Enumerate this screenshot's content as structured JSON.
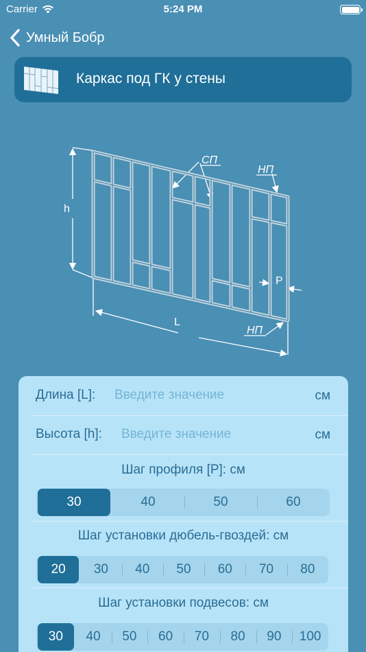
{
  "status_bar": {
    "carrier": "Carrier",
    "time": "5:24 PM"
  },
  "nav": {
    "back_label": "Умный Бобр"
  },
  "header": {
    "title": "Каркас под ГК у стены",
    "icon": "drywall-frame-icon"
  },
  "diagram": {
    "labels": {
      "sp": "СП",
      "np_top": "НП",
      "np_bottom": "НП",
      "h": "h",
      "l": "L",
      "p": "P"
    }
  },
  "form": {
    "length": {
      "label": "Длина [L]:",
      "placeholder": "Введите значение",
      "unit": "см",
      "value": ""
    },
    "height": {
      "label": "Высота [h]:",
      "placeholder": "Введите значение",
      "unit": "см",
      "value": ""
    },
    "profile_step": {
      "label": "Шаг профиля [P]: см",
      "options": [
        "30",
        "40",
        "50",
        "60"
      ],
      "selected": "30"
    },
    "dowel_step": {
      "label": "Шаг установки дюбель-гвоздей: см",
      "options": [
        "20",
        "30",
        "40",
        "50",
        "60",
        "70",
        "80"
      ],
      "selected": "20"
    },
    "hanger_step": {
      "label": "Шаг установки подвесов: см",
      "options": [
        "30",
        "40",
        "50",
        "60",
        "70",
        "80",
        "90",
        "100"
      ],
      "selected": "30"
    }
  },
  "colors": {
    "background": "#4a8fb4",
    "accent": "#1f6f98",
    "card": "#b7e3f8",
    "text": "#2a6d94"
  }
}
